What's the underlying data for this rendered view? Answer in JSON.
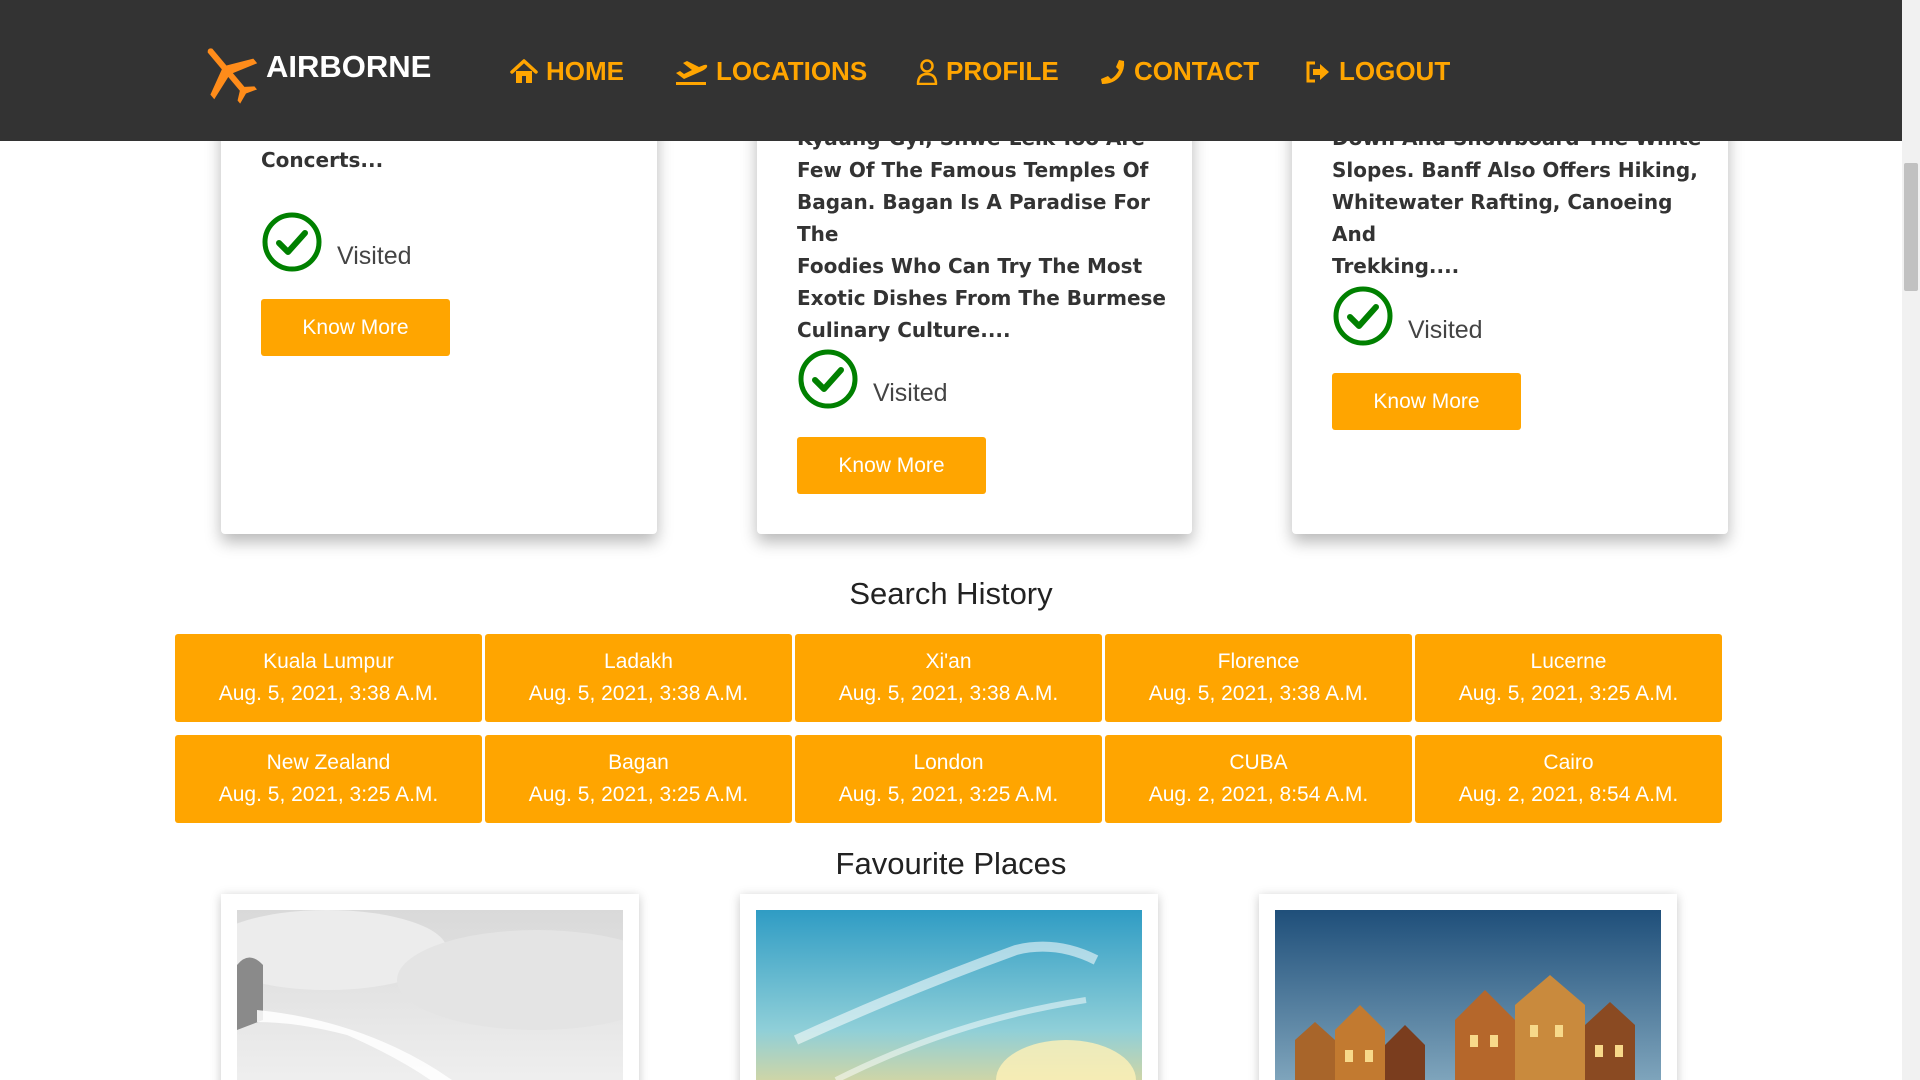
{
  "brand": {
    "name": "AIRBORNE"
  },
  "nav": [
    {
      "label": "HOME",
      "icon": "home-icon"
    },
    {
      "label": "LOCATIONS",
      "icon": "plane-departure-icon"
    },
    {
      "label": "PROFILE",
      "icon": "user-icon"
    },
    {
      "label": "CONTACT",
      "icon": "phone-icon"
    },
    {
      "label": "LOGOUT",
      "icon": "sign-out-icon"
    }
  ],
  "cards": [
    {
      "text_lines": [
        "Concerts..."
      ],
      "status": "Visited",
      "button": "Know More"
    },
    {
      "text_lines": [
        "Kyaung-Gyi, Shwe-Leik-Too Are",
        "Few Of The Famous Temples Of",
        "Bagan. Bagan Is A Paradise For The",
        "Foodies Who Can Try The Most",
        "Exotic Dishes From The Burmese",
        "Culinary Culture...."
      ],
      "status": "Visited",
      "button": "Know More"
    },
    {
      "text_lines": [
        "Down And Snowboard The White",
        "Slopes. Banff Also Offers Hiking,",
        "Whitewater Rafting, Canoeing And",
        "Trekking...."
      ],
      "status": "Visited",
      "button": "Know More"
    }
  ],
  "search_history": {
    "title": "Search History",
    "items": [
      {
        "place": "Kuala Lumpur",
        "time": "Aug. 5, 2021, 3:38 A.M."
      },
      {
        "place": "Ladakh",
        "time": "Aug. 5, 2021, 3:38 A.M."
      },
      {
        "place": "Xi'an",
        "time": "Aug. 5, 2021, 3:38 A.M."
      },
      {
        "place": "Florence",
        "time": "Aug. 5, 2021, 3:38 A.M."
      },
      {
        "place": "Lucerne",
        "time": "Aug. 5, 2021, 3:25 A.M."
      },
      {
        "place": "New Zealand",
        "time": "Aug. 5, 2021, 3:25 A.M."
      },
      {
        "place": "Bagan",
        "time": "Aug. 5, 2021, 3:25 A.M."
      },
      {
        "place": "London",
        "time": "Aug. 5, 2021, 3:25 A.M."
      },
      {
        "place": "CUBA",
        "time": "Aug. 2, 2021, 8:54 A.M."
      },
      {
        "place": "Cairo",
        "time": "Aug. 2, 2021, 8:54 A.M."
      }
    ]
  },
  "favourites": {
    "title": "Favourite Places"
  },
  "colors": {
    "accent": "#ffa500",
    "navbar": "#333333",
    "visited": "#008000"
  }
}
